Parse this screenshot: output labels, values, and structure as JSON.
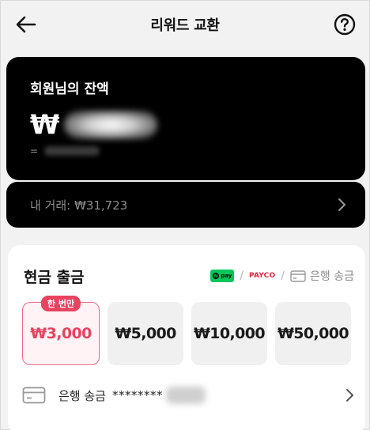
{
  "header": {
    "title": "리워드 교환",
    "back_icon": "arrow-left-icon",
    "help_icon": "question-circle-icon"
  },
  "balance": {
    "label": "회원님의 잔액",
    "currency_symbol": "₩",
    "sub_prefix": "="
  },
  "transactions": {
    "label": "내 거래: ₩31,723",
    "chevron_icon": "chevron-right-icon"
  },
  "cash_out": {
    "title": "현금 출금",
    "methods": {
      "npay": "pay",
      "npay_n": "N",
      "sep1": "/",
      "payco": "PAYCO",
      "sep2": "/",
      "bank": "은행 송금",
      "bank_icon": "card-icon"
    },
    "options": [
      {
        "label": "₩3,000",
        "badge": "한 번만",
        "selected": true
      },
      {
        "label": "₩5,000",
        "selected": false
      },
      {
        "label": "₩10,000",
        "selected": false
      },
      {
        "label": "₩50,000",
        "selected": false
      }
    ],
    "bank_row": {
      "label": "은행 송금",
      "account_masked": "********",
      "icon": "card-icon",
      "chevron_icon": "chevron-right-icon"
    }
  },
  "colors": {
    "accent": "#e8435f",
    "selected_border": "#f06b84",
    "selected_bg": "#fff3f5",
    "npay_green": "#03c75a",
    "payco_red": "#e8243a"
  }
}
